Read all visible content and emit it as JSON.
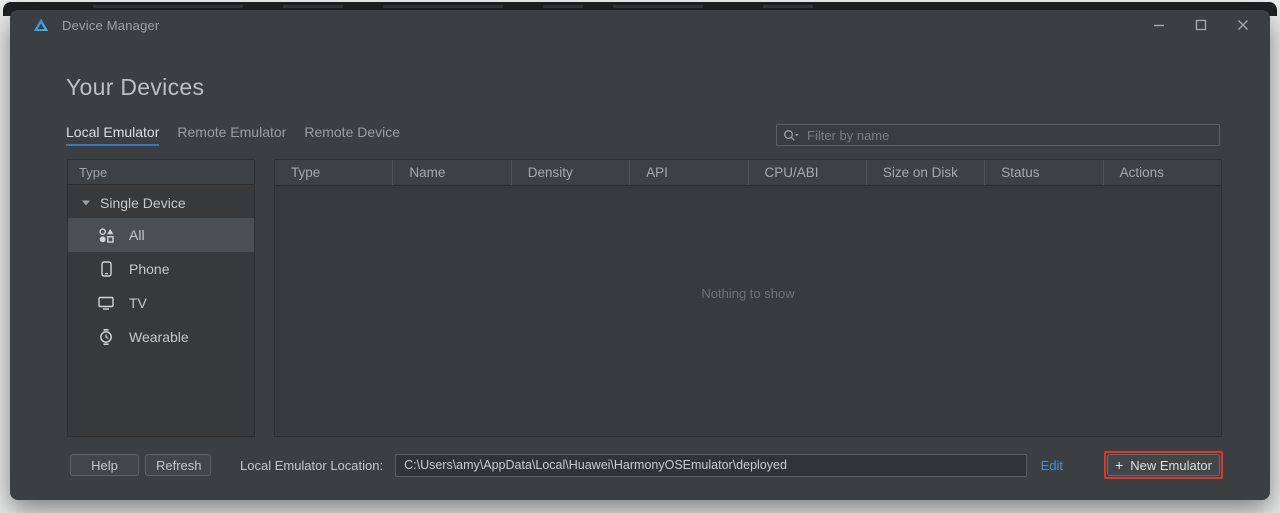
{
  "window": {
    "title": "Device Manager"
  },
  "page": {
    "heading": "Your Devices"
  },
  "tabs": [
    {
      "label": "Local Emulator",
      "active": true
    },
    {
      "label": "Remote Emulator",
      "active": false
    },
    {
      "label": "Remote Device",
      "active": false
    }
  ],
  "filter": {
    "placeholder": "Filter by name"
  },
  "sidebar": {
    "header": "Type",
    "group_label": "Single Device",
    "items": [
      {
        "label": "All",
        "icon": "all-categories-icon",
        "selected": true
      },
      {
        "label": "Phone",
        "icon": "phone-icon",
        "selected": false
      },
      {
        "label": "TV",
        "icon": "tv-icon",
        "selected": false
      },
      {
        "label": "Wearable",
        "icon": "wearable-watch-icon",
        "selected": false
      }
    ]
  },
  "table": {
    "columns": [
      "Type",
      "Name",
      "Density",
      "API",
      "CPU/ABI",
      "Size on Disk",
      "Status",
      "Actions"
    ],
    "rows": [],
    "empty_text": "Nothing to show"
  },
  "footer": {
    "help_label": "Help",
    "refresh_label": "Refresh",
    "location_label": "Local Emulator Location:",
    "location_value": "C:\\Users\\amy\\AppData\\Local\\Huawei\\HarmonyOSEmulator\\deployed",
    "edit_label": "Edit",
    "new_emulator_plus": "+",
    "new_emulator_label": "New Emulator"
  },
  "icons": {
    "app_logo": "deveco-studio-logo (gradient triangle)",
    "search": "magnifier-with-dropdown-caret",
    "group_caret": "triangle-down",
    "all": "shape-grid (circle, triangle, dot, square)",
    "phone": "smartphone-outline",
    "tv": "monitor-outline",
    "wearable": "watch-outline",
    "minimize": "horizontal-dash",
    "maximize": "square-outline",
    "close": "x-cross",
    "plus": "+"
  },
  "colors": {
    "dialog_bg": "#3c3f41",
    "panel_bg": "#37393b",
    "selected_row": "#4b4f52",
    "tab_underline_blue": "#3d74b8",
    "edit_link_blue": "#4a90d9",
    "highlight_red": "#e0352b"
  }
}
